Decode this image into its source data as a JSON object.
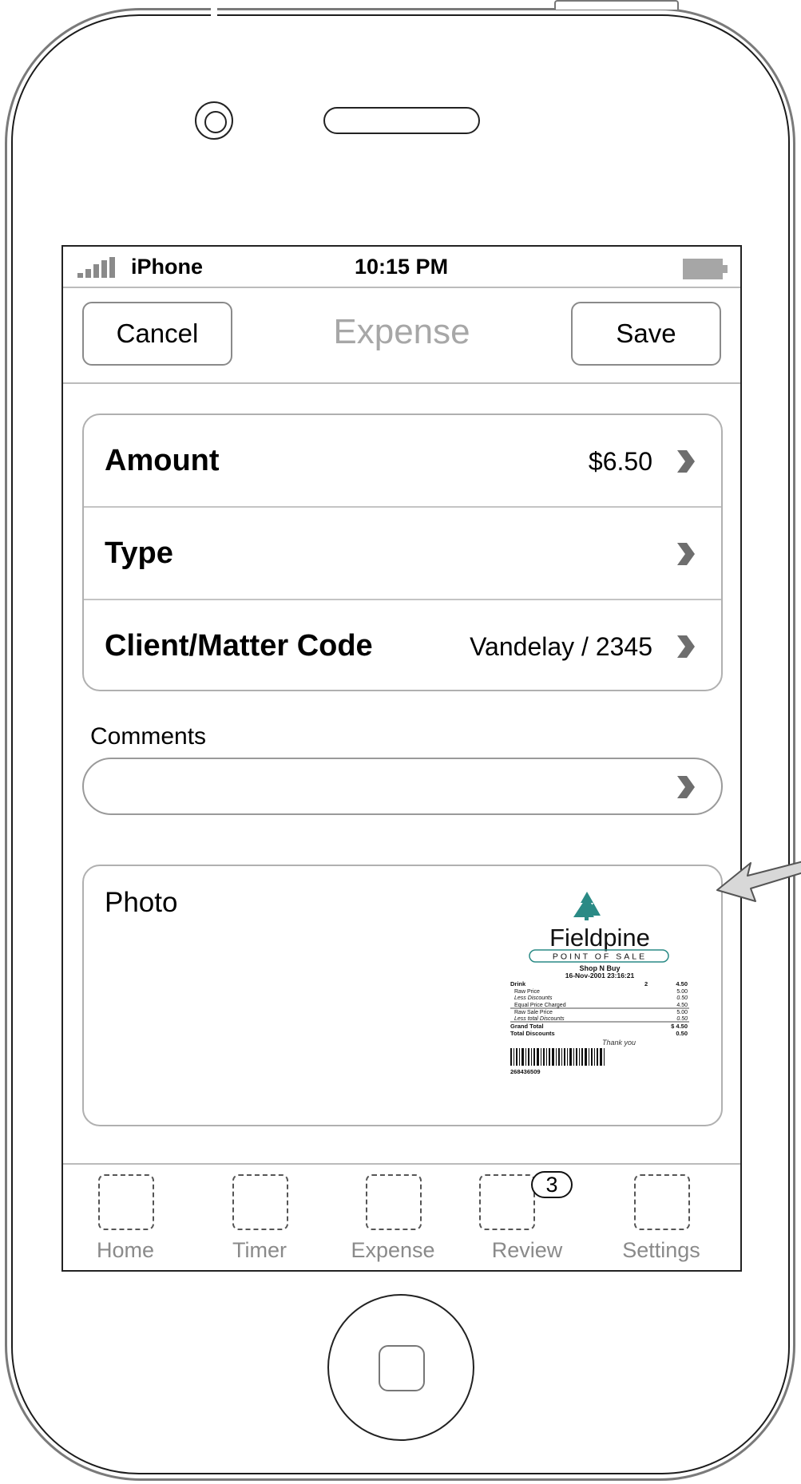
{
  "status_bar": {
    "carrier": "iPhone",
    "time": "10:15 PM"
  },
  "nav_bar": {
    "title": "Expense",
    "left_button": "Cancel",
    "right_button": "Save"
  },
  "form_rows": [
    {
      "label": "Amount",
      "value": "$6.50"
    },
    {
      "label": "Type",
      "value": ""
    },
    {
      "label": "Client/Matter Code",
      "value": "Vandelay / 2345"
    }
  ],
  "comments": {
    "label": "Comments",
    "value": ""
  },
  "photo": {
    "label": "Photo",
    "receipt": {
      "brand": "Fieldpine",
      "tagline": "POINT OF SALE",
      "store": "Shop N Buy",
      "datetime": "16-Nov-2001 23:16:21",
      "item_name": "Drink",
      "item_qty": "2",
      "item_total": "4.50",
      "lines": [
        {
          "label": "Raw Price",
          "value": "5.00"
        },
        {
          "label": "Less Discounts",
          "value": "0.50"
        },
        {
          "label": "Equal Price Charged",
          "value": "4.50"
        },
        {
          "label": "Raw Sale Price",
          "value": "5.00"
        },
        {
          "label": "Less total Discounts",
          "value": "0.50"
        }
      ],
      "grand_total_label": "Grand Total",
      "grand_total_value": "$ 4.50",
      "total_discounts_label": "Total Discounts",
      "total_discounts_value": "0.50",
      "thanks": "Thank you",
      "barcode_number": "268436509"
    }
  },
  "tab_bar": {
    "tabs": [
      {
        "label": "Home"
      },
      {
        "label": "Timer"
      },
      {
        "label": "Expense"
      },
      {
        "label": "Review",
        "badge": "3"
      },
      {
        "label": "Settings"
      }
    ]
  },
  "colors": {
    "nav_title": "#a7a7a7",
    "tab_label": "#8a8a8a",
    "chevron": "#6e6e6e",
    "receipt_tree": "#2a8a85"
  },
  "icons": {
    "chevron": "chevron-right-icon",
    "signal": "signal-strength-icon",
    "battery": "battery-icon"
  }
}
